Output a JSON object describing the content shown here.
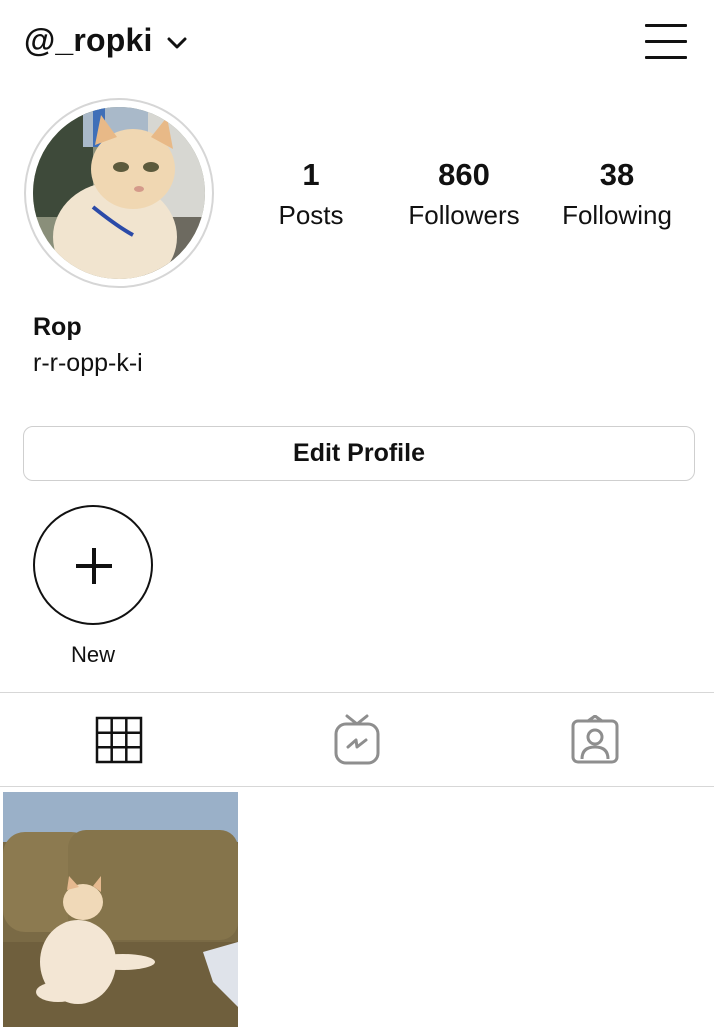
{
  "header": {
    "username": "@_ropki",
    "chevron_icon": "chevron-down-icon",
    "menu_icon": "hamburger-menu-icon"
  },
  "profile": {
    "avatar_icon": "cat-profile-photo",
    "name": "Rop",
    "bio": "r-r-opp-k-i"
  },
  "stats": [
    {
      "value": "1",
      "label": "Posts"
    },
    {
      "value": "860",
      "label": "Followers"
    },
    {
      "value": "38",
      "label": "Following"
    }
  ],
  "edit_profile_label": "Edit Profile",
  "highlights": {
    "new_label": "New",
    "new_icon": "plus-icon"
  },
  "tabs": [
    {
      "icon": "grid-icon",
      "active": true
    },
    {
      "icon": "igtv-icon",
      "active": false
    },
    {
      "icon": "tagged-person-icon",
      "active": false
    }
  ],
  "colors": {
    "text": "#111111",
    "divider": "#d7d7d7",
    "inactive_icon": "#8e8e8e",
    "border": "#cfcfcf"
  }
}
